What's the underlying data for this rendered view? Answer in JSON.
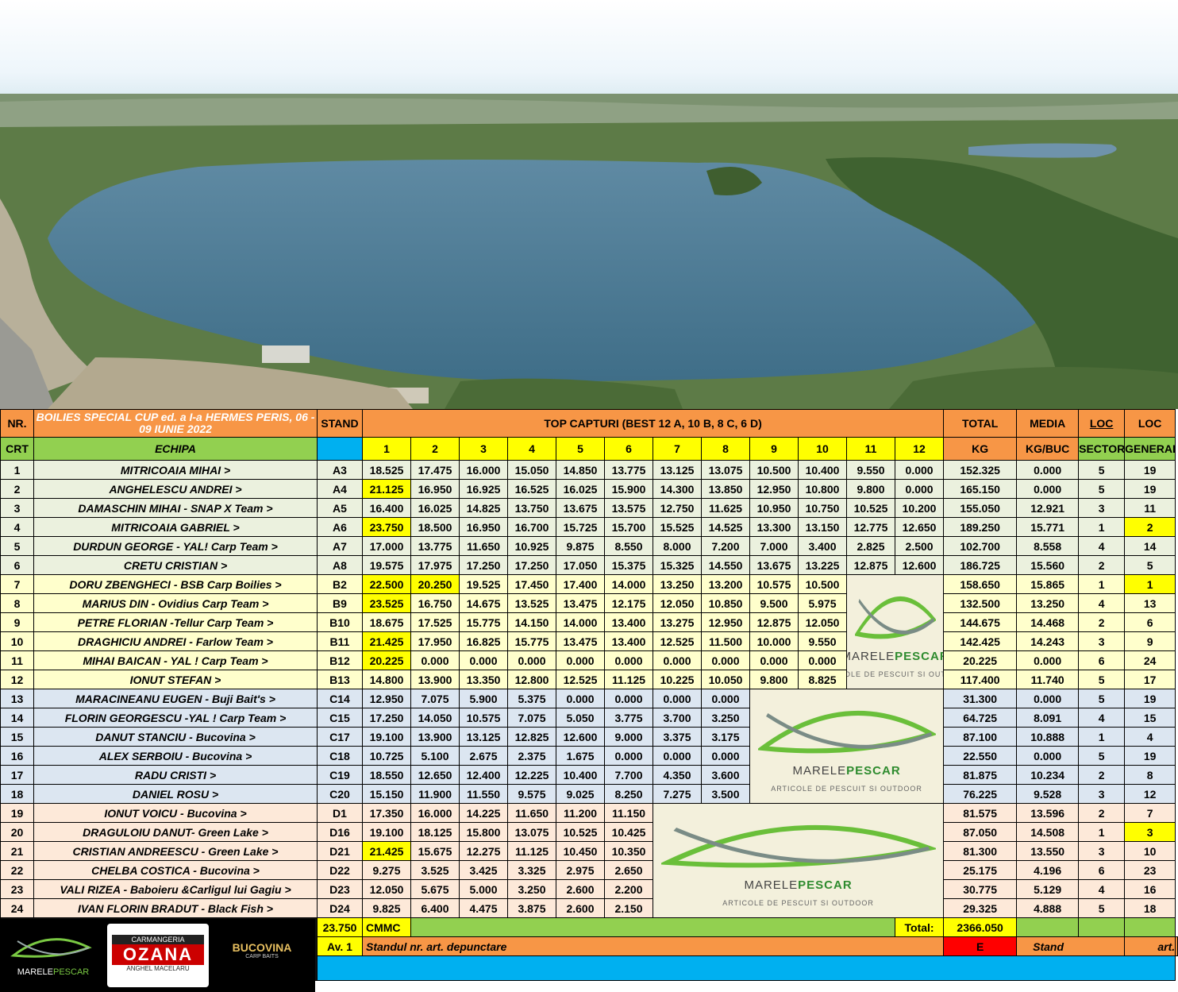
{
  "header": {
    "nr": "NR.",
    "crt": "CRT",
    "title": "BOILIES SPECIAL CUP ed. a I-a  HERMES PERIS, 06 - 09 IUNIE 2022",
    "echipa": "ECHIPA",
    "stand": "STAND",
    "top": "TOP CAPTURI (BEST 12 A, 10 B, 8 C, 6 D)",
    "cols": [
      "1",
      "2",
      "3",
      "4",
      "5",
      "6",
      "7",
      "8",
      "9",
      "10",
      "11",
      "12"
    ],
    "total": "TOTAL",
    "kg": "KG",
    "media": "MEDIA",
    "kgbuc": "KG/BUC",
    "loc1": "LOC",
    "sector": "SECTOR",
    "loc2": "LOC",
    "general": "GENERAL"
  },
  "rows": [
    {
      "nr": "1",
      "team": "MITRICOAIA MIHAI  >",
      "stand": "A3",
      "vals": [
        "18.525",
        "17.475",
        "16.000",
        "15.050",
        "14.850",
        "13.775",
        "13.125",
        "13.075",
        "10.500",
        "10.400",
        "9.550",
        "0.000"
      ],
      "total": "152.325",
      "media": "0.000",
      "sector": "5",
      "general": "19"
    },
    {
      "nr": "2",
      "team": "ANGHELESCU ANDREI  >",
      "stand": "A4",
      "vals": [
        "21.125",
        "16.950",
        "16.925",
        "16.525",
        "16.025",
        "15.900",
        "14.300",
        "13.850",
        "12.950",
        "10.800",
        "9.800",
        "0.000"
      ],
      "total": "165.150",
      "media": "0.000",
      "sector": "5",
      "general": "19"
    },
    {
      "nr": "3",
      "team": "DAMASCHIN MIHAI - SNAP X Team >",
      "stand": "A5",
      "vals": [
        "16.400",
        "16.025",
        "14.825",
        "13.750",
        "13.675",
        "13.575",
        "12.750",
        "11.625",
        "10.950",
        "10.750",
        "10.525",
        "10.200"
      ],
      "total": "155.050",
      "media": "12.921",
      "sector": "3",
      "general": "11"
    },
    {
      "nr": "4",
      "team": "MITRICOAIA GABRIEL  >",
      "stand": "A6",
      "vals": [
        "23.750",
        "18.500",
        "16.950",
        "16.700",
        "15.725",
        "15.700",
        "15.525",
        "14.525",
        "13.300",
        "13.150",
        "12.775",
        "12.650"
      ],
      "total": "189.250",
      "media": "15.771",
      "sector": "1",
      "general": "2"
    },
    {
      "nr": "5",
      "team": "DURDUN GEORGE - YAL! Carp Team >",
      "stand": "A7",
      "vals": [
        "17.000",
        "13.775",
        "11.650",
        "10.925",
        "9.875",
        "8.550",
        "8.000",
        "7.200",
        "7.000",
        "3.400",
        "2.825",
        "2.500"
      ],
      "total": "102.700",
      "media": "8.558",
      "sector": "4",
      "general": "14"
    },
    {
      "nr": "6",
      "team": "CRETU  CRISTIAN  >",
      "stand": "A8",
      "vals": [
        "19.575",
        "17.975",
        "17.250",
        "17.250",
        "17.050",
        "15.375",
        "15.325",
        "14.550",
        "13.675",
        "13.225",
        "12.875",
        "12.600"
      ],
      "total": "186.725",
      "media": "15.560",
      "sector": "2",
      "general": "5"
    },
    {
      "nr": "7",
      "team": "DORU  ZBENGHECI - BSB Carp Boilies >",
      "stand": "B2",
      "vals": [
        "22.500",
        "20.250",
        "19.525",
        "17.450",
        "17.400",
        "14.000",
        "13.250",
        "13.200",
        "10.575",
        "10.500"
      ],
      "total": "158.650",
      "media": "15.865",
      "sector": "1",
      "general": "1"
    },
    {
      "nr": "8",
      "team": "MARIUS DIN - Ovidius Carp Team >",
      "stand": "B9",
      "vals": [
        "23.525",
        "16.750",
        "14.675",
        "13.525",
        "13.475",
        "12.175",
        "12.050",
        "10.850",
        "9.500",
        "5.975"
      ],
      "total": "132.500",
      "media": "13.250",
      "sector": "4",
      "general": "13"
    },
    {
      "nr": "9",
      "team": "PETRE  FLORIAN -Tellur Carp Team >",
      "stand": "B10",
      "vals": [
        "18.675",
        "17.525",
        "15.775",
        "14.150",
        "14.000",
        "13.400",
        "13.275",
        "12.950",
        "12.875",
        "12.050"
      ],
      "total": "144.675",
      "media": "14.468",
      "sector": "2",
      "general": "6"
    },
    {
      "nr": "10",
      "team": "DRAGHICIU ANDREI - Farlow Team >",
      "stand": "B11",
      "vals": [
        "21.425",
        "17.950",
        "16.825",
        "15.775",
        "13.475",
        "13.400",
        "12.525",
        "11.500",
        "10.000",
        "9.550"
      ],
      "total": "142.425",
      "media": "14.243",
      "sector": "3",
      "general": "9"
    },
    {
      "nr": "11",
      "team": "MIHAI BAICAN - YAL ! Carp Team >",
      "stand": "B12",
      "vals": [
        "20.225",
        "0.000",
        "0.000",
        "0.000",
        "0.000",
        "0.000",
        "0.000",
        "0.000",
        "0.000",
        "0.000"
      ],
      "total": "20.225",
      "media": "0.000",
      "sector": "6",
      "general": "24"
    },
    {
      "nr": "12",
      "team": "IONUT STEFAN  >",
      "stand": "B13",
      "vals": [
        "14.800",
        "13.900",
        "13.350",
        "12.800",
        "12.525",
        "11.125",
        "10.225",
        "10.050",
        "9.800",
        "8.825"
      ],
      "total": "117.400",
      "media": "11.740",
      "sector": "5",
      "general": "17"
    },
    {
      "nr": "13",
      "team": "MARACINEANU EUGEN - Buji Bait's >",
      "stand": "C14",
      "vals": [
        "12.950",
        "7.075",
        "5.900",
        "5.375",
        "0.000",
        "0.000",
        "0.000",
        "0.000"
      ],
      "total": "31.300",
      "media": "0.000",
      "sector": "5",
      "general": "19"
    },
    {
      "nr": "14",
      "team": "FLORIN GEORGESCU -YAL ! Carp Team >",
      "stand": "C15",
      "vals": [
        "17.250",
        "14.050",
        "10.575",
        "7.075",
        "5.050",
        "3.775",
        "3.700",
        "3.250"
      ],
      "total": "64.725",
      "media": "8.091",
      "sector": "4",
      "general": "15"
    },
    {
      "nr": "15",
      "team": "DANUT STANCIU - Bucovina >",
      "stand": "C17",
      "vals": [
        "19.100",
        "13.900",
        "13.125",
        "12.825",
        "12.600",
        "9.000",
        "3.375",
        "3.175"
      ],
      "total": "87.100",
      "media": "10.888",
      "sector": "1",
      "general": "4"
    },
    {
      "nr": "16",
      "team": "ALEX SERBOIU - Bucovina  >",
      "stand": "C18",
      "vals": [
        "10.725",
        "5.100",
        "2.675",
        "2.375",
        "1.675",
        "0.000",
        "0.000",
        "0.000"
      ],
      "total": "22.550",
      "media": "0.000",
      "sector": "5",
      "general": "19"
    },
    {
      "nr": "17",
      "team": "RADU CRISTI  >",
      "stand": "C19",
      "vals": [
        "18.550",
        "12.650",
        "12.400",
        "12.225",
        "10.400",
        "7.700",
        "4.350",
        "3.600"
      ],
      "total": "81.875",
      "media": "10.234",
      "sector": "2",
      "general": "8"
    },
    {
      "nr": "18",
      "team": "DANIEL ROSU  >",
      "stand": "C20",
      "vals": [
        "15.150",
        "11.900",
        "11.550",
        "9.575",
        "9.025",
        "8.250",
        "7.275",
        "3.500"
      ],
      "total": "76.225",
      "media": "9.528",
      "sector": "3",
      "general": "12"
    },
    {
      "nr": "19",
      "team": "IONUT  VOICU  - Bucovina >",
      "stand": "D1",
      "vals": [
        "17.350",
        "16.000",
        "14.225",
        "11.650",
        "11.200",
        "11.150"
      ],
      "total": "81.575",
      "media": "13.596",
      "sector": "2",
      "general": "7"
    },
    {
      "nr": "20",
      "team": "DRAGULOIU DANUT- Green Lake  >",
      "stand": "D16",
      "vals": [
        "19.100",
        "18.125",
        "15.800",
        "13.075",
        "10.525",
        "10.425"
      ],
      "total": "87.050",
      "media": "14.508",
      "sector": "1",
      "general": "3"
    },
    {
      "nr": "21",
      "team": "CRISTIAN ANDREESCU - Green Lake >",
      "stand": "D21",
      "vals": [
        "21.425",
        "15.675",
        "12.275",
        "11.125",
        "10.450",
        "10.350"
      ],
      "total": "81.300",
      "media": "13.550",
      "sector": "3",
      "general": "10"
    },
    {
      "nr": "22",
      "team": "CHELBA COSTICA - Bucovina >",
      "stand": "D22",
      "vals": [
        "9.275",
        "3.525",
        "3.425",
        "3.325",
        "2.975",
        "2.650"
      ],
      "total": "25.175",
      "media": "4.196",
      "sector": "6",
      "general": "23"
    },
    {
      "nr": "23",
      "team": "VALI RIZEA - Baboieru &Carligul lui Gagiu >",
      "stand": "D23",
      "vals": [
        "12.050",
        "5.675",
        "5.000",
        "3.250",
        "2.600",
        "2.200"
      ],
      "total": "30.775",
      "media": "5.129",
      "sector": "4",
      "general": "16"
    },
    {
      "nr": "24",
      "team": "IVAN FLORIN BRADUT - Black Fish >",
      "stand": "D24",
      "vals": [
        "9.825",
        "6.400",
        "4.475",
        "3.875",
        "2.600",
        "2.150"
      ],
      "total": "29.325",
      "media": "4.888",
      "sector": "5",
      "general": "18"
    }
  ],
  "footer": {
    "cmmc_value": "23.750",
    "cmmc_label": "CMMC",
    "total_label": "Total:",
    "total_value": "2366.050",
    "av": "Av. 1",
    "standul": "Standul  nr.      art.      depunctare",
    "e": "E",
    "stand": "Stand",
    "art": "art."
  },
  "logos": {
    "marele_a": "MARELE",
    "marele_b": "PESCAR",
    "marele_sub": "ARTICOLE DE PESCUIT SI OUTDOOR",
    "ozana_top": "CARMANGERIA",
    "ozana_main": "OZANA",
    "ozana_sub": "ANGHEL MACELARU",
    "bucovina": "BUCOVINA",
    "bucovina_sub": "CARP BAITS"
  },
  "colors": {
    "header_orange": "#f79646",
    "green": "#92d050",
    "blue": "#00b0f0",
    "highlight": "#ffff00"
  }
}
